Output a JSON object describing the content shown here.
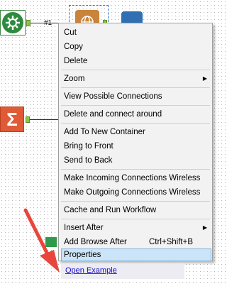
{
  "canvas": {
    "connection_label": "#1"
  },
  "context_menu": {
    "items": [
      {
        "label": "Cut"
      },
      {
        "label": "Copy"
      },
      {
        "label": "Delete"
      },
      {
        "label": "Zoom",
        "submenu": true
      },
      {
        "label": "View Possible Connections"
      },
      {
        "label": "Delete and connect around"
      },
      {
        "label": "Add To New Container"
      },
      {
        "label": "Bring to Front"
      },
      {
        "label": "Send to Back"
      },
      {
        "label": "Make Incoming Connections Wireless"
      },
      {
        "label": "Make Outgoing Connections Wireless"
      },
      {
        "label": "Cache and Run Workflow"
      },
      {
        "label": "Insert After",
        "submenu": true
      },
      {
        "label": "Add Browse After",
        "shortcut": "Ctrl+Shift+B"
      },
      {
        "label": "Properties",
        "highlighted": true
      }
    ]
  },
  "link": {
    "label": "Open Example"
  },
  "colors": {
    "annotation_arrow": "#e8463c",
    "highlight": "#cce4f7",
    "link": "#1a0dcc"
  }
}
